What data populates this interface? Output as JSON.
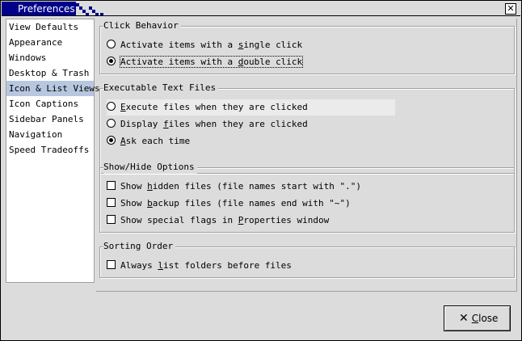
{
  "window": {
    "title": "Preferences",
    "close_glyph": "✕"
  },
  "sidebar": {
    "items": [
      {
        "label": "View Defaults"
      },
      {
        "label": "Appearance"
      },
      {
        "label": "Windows"
      },
      {
        "label": "Desktop & Trash"
      },
      {
        "label": "Icon & List Views",
        "selected": true
      },
      {
        "label": "Icon Captions"
      },
      {
        "label": "Sidebar Panels"
      },
      {
        "label": "Navigation"
      },
      {
        "label": "Speed Tradeoffs"
      }
    ]
  },
  "click_behavior": {
    "title": "Click Behavior",
    "single": {
      "pre": "Activate items with a ",
      "mn": "s",
      "post": "ingle click",
      "checked": false
    },
    "double": {
      "pre": "Activate items with a ",
      "mn": "d",
      "post": "ouble click",
      "checked": true
    }
  },
  "executable": {
    "title": "Executable Text Files",
    "execute": {
      "pre": "",
      "mn": "E",
      "post": "xecute files when they are clicked",
      "checked": false
    },
    "display": {
      "pre": "Display ",
      "mn": "f",
      "post": "iles when they are clicked",
      "checked": false
    },
    "ask": {
      "pre": "",
      "mn": "A",
      "post": "sk each time",
      "checked": true
    }
  },
  "show_hide": {
    "title": "Show/Hide Options",
    "hidden": {
      "pre": "Show ",
      "mn": "h",
      "post": "idden files (file names start with \".\")",
      "checked": false
    },
    "backup": {
      "pre": "Show ",
      "mn": "b",
      "post": "ackup files (file names end with \"~\")",
      "checked": false
    },
    "flags": {
      "pre": "Show special flags in ",
      "mn": "P",
      "post": "roperties window",
      "checked": false
    }
  },
  "sorting": {
    "title": "Sorting Order",
    "folders": {
      "pre": "Always ",
      "mn": "l",
      "post": "ist folders before files",
      "checked": false
    }
  },
  "close_button": {
    "mn": "C",
    "post": "lose",
    "icon": "close-icon"
  }
}
